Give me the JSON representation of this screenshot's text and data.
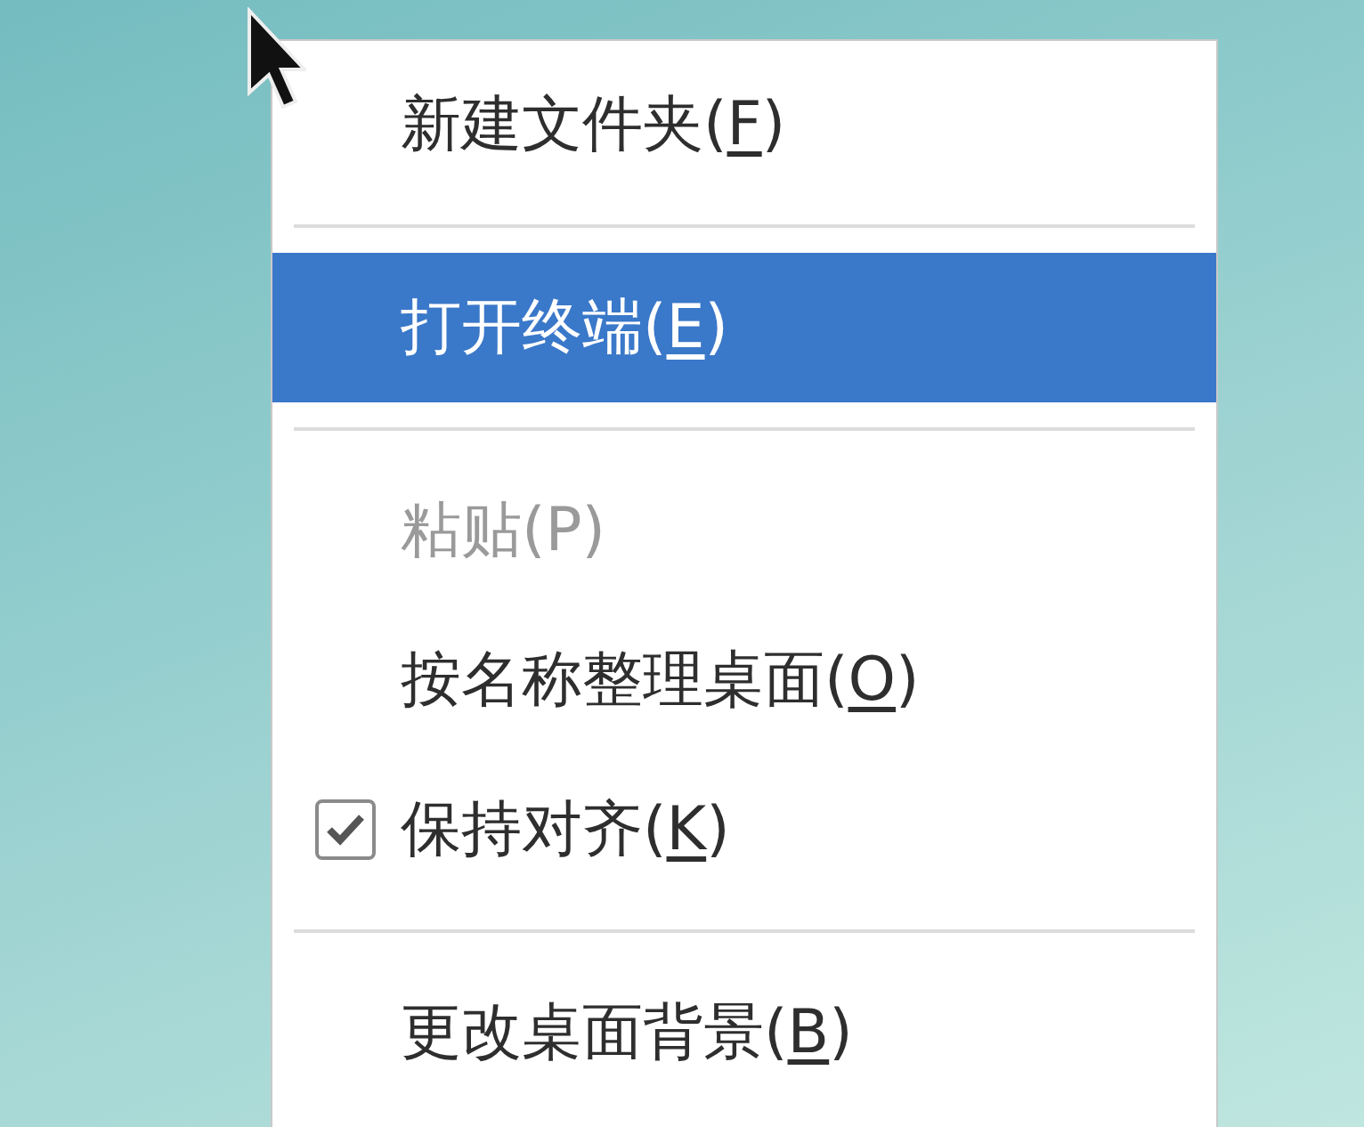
{
  "menu": {
    "items": [
      {
        "kind": "item",
        "label": "新建文件夹(F)",
        "mnemonic_underlined": true,
        "selected": false,
        "disabled": false
      },
      {
        "kind": "separator"
      },
      {
        "kind": "item",
        "label": "打开终端(E)",
        "mnemonic_underlined": true,
        "selected": true,
        "disabled": false
      },
      {
        "kind": "separator"
      },
      {
        "kind": "item",
        "label": "粘贴(P)",
        "mnemonic_underlined": false,
        "selected": false,
        "disabled": true
      },
      {
        "kind": "item",
        "label": "按名称整理桌面(O)",
        "mnemonic_underlined": true,
        "selected": false,
        "disabled": false
      },
      {
        "kind": "check",
        "label": "保持对齐(K)",
        "mnemonic_underlined": true,
        "checked": true,
        "selected": false,
        "disabled": false
      },
      {
        "kind": "separator"
      },
      {
        "kind": "item",
        "label": "更改桌面背景(B)",
        "mnemonic_underlined": true,
        "selected": false,
        "disabled": false
      }
    ]
  }
}
